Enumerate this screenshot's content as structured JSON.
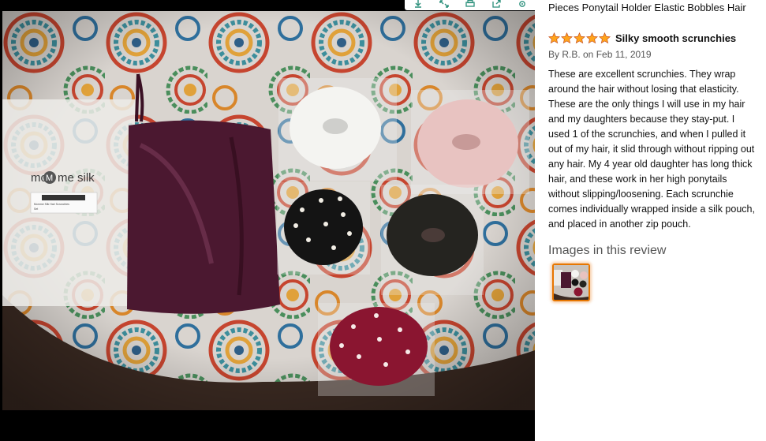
{
  "toolbar": {
    "icons": [
      "download-icon",
      "expand-icon",
      "print-icon",
      "share-icon",
      "settings-icon"
    ]
  },
  "photo": {
    "package_brand": "mo",
    "package_brand_m": "M",
    "package_brand_end": "me silk",
    "package_sticker_line1": "Momme Silk Hair Scrunchies",
    "package_sticker_line2": "Set"
  },
  "review": {
    "product_title": "Pieces Ponytail Holder Elastic Bobbles Hair",
    "rating": 5,
    "star_color": "#FFA41C",
    "title": "Silky smooth scrunchies",
    "byline": "By R.B. on Feb 11, 2019",
    "body_lines": [
      "These are excellent scrunchies. They wrap",
      "around the hair without losing that elasticity.",
      "These are the only things I will use in my hair",
      "and my daughters because they stay-put. I",
      "used 1 of the scrunchies, and when I pulled it",
      "out of my hair, it slid through without ripping out",
      "any hair. My 4 year old daughter has long thick",
      "hair, and these work in her high ponytails",
      "without slipping/loosening. Each scrunchie",
      "comes individually wrapped inside a silk pouch,",
      "and placed in another zip pouch."
    ],
    "images_heading": "Images in this review",
    "thumb_border_color": "#E77600"
  }
}
